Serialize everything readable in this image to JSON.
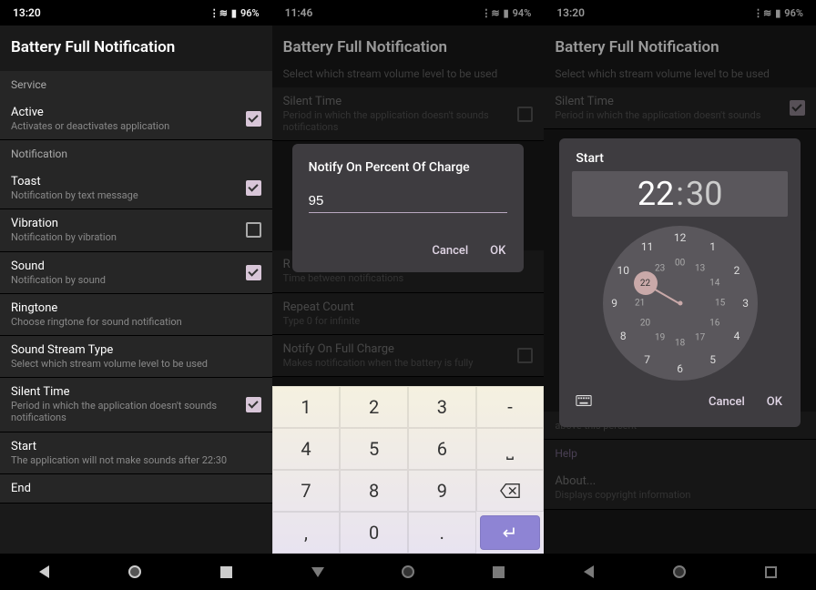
{
  "s1": {
    "status": {
      "time": "13:20",
      "battery": "96%"
    },
    "title": "Battery Full Notification",
    "sections": {
      "service": "Service",
      "notification": "Notification"
    },
    "items": {
      "active": {
        "t": "Active",
        "s": "Activates or deactivates application"
      },
      "toast": {
        "t": "Toast",
        "s": "Notification by text message"
      },
      "vibration": {
        "t": "Vibration",
        "s": "Notification by vibration"
      },
      "sound": {
        "t": "Sound",
        "s": "Notification by sound"
      },
      "ringtone": {
        "t": "Ringtone",
        "s": "Choose ringtone for sound notification"
      },
      "stream": {
        "t": "Sound Stream Type",
        "s": "Select which stream volume level to be used"
      },
      "silent": {
        "t": "Silent Time",
        "s": "Period in which the application doesn't sounds notifications"
      },
      "start": {
        "t": "Start",
        "s": "The application will not make sounds after 22:30"
      },
      "end": {
        "t": "End"
      }
    }
  },
  "s2": {
    "status": {
      "time": "11:46",
      "battery": "94%"
    },
    "title": "Battery Full Notification",
    "subtitle": "Select which stream volume level to be used",
    "items": {
      "silent": {
        "t": "Silent Time",
        "s": "Period in which the application doesn't sounds notifications"
      },
      "repeat_hint": "Time between notifications",
      "repeat_count": {
        "t": "Repeat Count",
        "s": "Type 0 for infinite"
      },
      "full": {
        "t": "Notify On Full Charge",
        "s": "Makes notification when the battery is fully"
      }
    },
    "dialog": {
      "title": "Notify On Percent Of Charge",
      "value": "95",
      "cancel": "Cancel",
      "ok": "OK"
    },
    "keypad": {
      "labels": [
        "1",
        "2",
        "3",
        "-",
        "4",
        "5",
        "6",
        "␣",
        "7",
        "8",
        "9",
        "⌫",
        ",",
        "0",
        ".",
        "↵"
      ]
    }
  },
  "s3": {
    "status": {
      "time": "13:20",
      "battery": "96%"
    },
    "title": "Battery Full Notification",
    "subtitle": "Select which stream volume level to be used",
    "items": {
      "silent": {
        "t": "Silent Time",
        "s": "Period in which the application doesn't sounds"
      },
      "above": "above this percent",
      "help": "Help",
      "about": {
        "t": "About...",
        "s": "Displays copyright information"
      }
    },
    "picker": {
      "title": "Start",
      "hour": "22",
      "minute": "30",
      "cancel": "Cancel",
      "ok": "OK",
      "outer": [
        "12",
        "1",
        "2",
        "3",
        "4",
        "5",
        "6",
        "7",
        "8",
        "9",
        "10",
        "11"
      ],
      "inner": [
        "00",
        "13",
        "14",
        "15",
        "16",
        "17",
        "18",
        "19",
        "20",
        "21",
        "22",
        "23"
      ],
      "selected_inner_index": 10
    }
  }
}
